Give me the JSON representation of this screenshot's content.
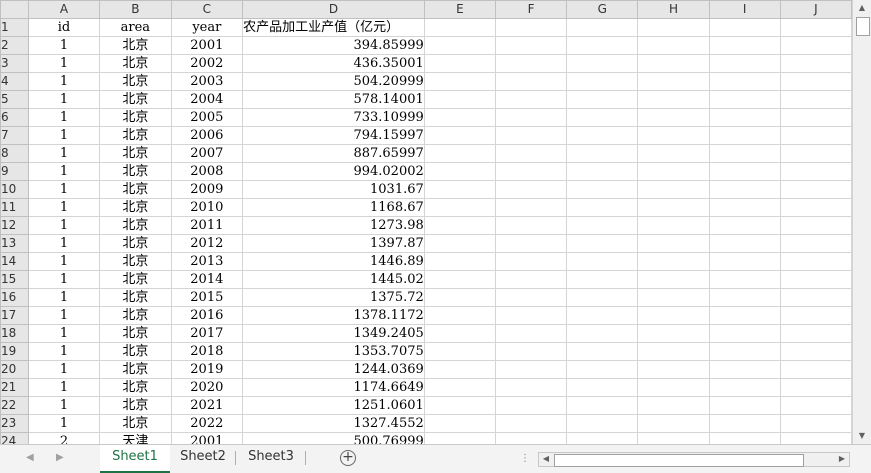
{
  "columns": [
    "A",
    "B",
    "C",
    "D",
    "E",
    "F",
    "G",
    "H",
    "I",
    "J"
  ],
  "header_row": {
    "num": "1",
    "cells": [
      "id",
      "area",
      "year",
      "农产品加工业产值（亿元）"
    ]
  },
  "rows": [
    {
      "num": "2",
      "id": "1",
      "area": "北京",
      "year": "2001",
      "value": "394.85999"
    },
    {
      "num": "3",
      "id": "1",
      "area": "北京",
      "year": "2002",
      "value": "436.35001"
    },
    {
      "num": "4",
      "id": "1",
      "area": "北京",
      "year": "2003",
      "value": "504.20999"
    },
    {
      "num": "5",
      "id": "1",
      "area": "北京",
      "year": "2004",
      "value": "578.14001"
    },
    {
      "num": "6",
      "id": "1",
      "area": "北京",
      "year": "2005",
      "value": "733.10999"
    },
    {
      "num": "7",
      "id": "1",
      "area": "北京",
      "year": "2006",
      "value": "794.15997"
    },
    {
      "num": "8",
      "id": "1",
      "area": "北京",
      "year": "2007",
      "value": "887.65997"
    },
    {
      "num": "9",
      "id": "1",
      "area": "北京",
      "year": "2008",
      "value": "994.02002"
    },
    {
      "num": "10",
      "id": "1",
      "area": "北京",
      "year": "2009",
      "value": "1031.67"
    },
    {
      "num": "11",
      "id": "1",
      "area": "北京",
      "year": "2010",
      "value": "1168.67"
    },
    {
      "num": "12",
      "id": "1",
      "area": "北京",
      "year": "2011",
      "value": "1273.98"
    },
    {
      "num": "13",
      "id": "1",
      "area": "北京",
      "year": "2012",
      "value": "1397.87"
    },
    {
      "num": "14",
      "id": "1",
      "area": "北京",
      "year": "2013",
      "value": "1446.89"
    },
    {
      "num": "15",
      "id": "1",
      "area": "北京",
      "year": "2014",
      "value": "1445.02"
    },
    {
      "num": "16",
      "id": "1",
      "area": "北京",
      "year": "2015",
      "value": "1375.72"
    },
    {
      "num": "17",
      "id": "1",
      "area": "北京",
      "year": "2016",
      "value": "1378.1172"
    },
    {
      "num": "18",
      "id": "1",
      "area": "北京",
      "year": "2017",
      "value": "1349.2405"
    },
    {
      "num": "19",
      "id": "1",
      "area": "北京",
      "year": "2018",
      "value": "1353.7075"
    },
    {
      "num": "20",
      "id": "1",
      "area": "北京",
      "year": "2019",
      "value": "1244.0369"
    },
    {
      "num": "21",
      "id": "1",
      "area": "北京",
      "year": "2020",
      "value": "1174.6649"
    },
    {
      "num": "22",
      "id": "1",
      "area": "北京",
      "year": "2021",
      "value": "1251.0601"
    },
    {
      "num": "23",
      "id": "1",
      "area": "北京",
      "year": "2022",
      "value": "1327.4552"
    },
    {
      "num": "24",
      "id": "2",
      "area": "天津",
      "year": "2001",
      "value": "500.76999"
    }
  ],
  "sheet_tabs": [
    "Sheet1",
    "Sheet2",
    "Sheet3"
  ],
  "active_tab": "Sheet1",
  "add_sheet_symbol": "+",
  "colors": {
    "accent": "#1f7244",
    "header_bg": "#e6e6e6",
    "grid": "#d4d4d4"
  }
}
